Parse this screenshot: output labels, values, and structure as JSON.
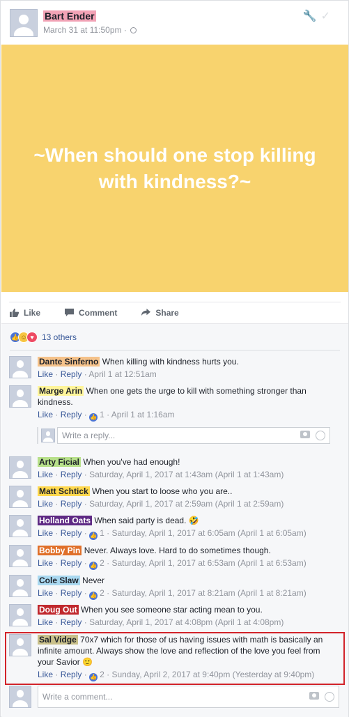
{
  "post": {
    "author": "Bart Ender",
    "author_highlight": "#f2a3b6",
    "timestamp": "March 31 at 11:50pm ·",
    "header_icons": [
      "wrench-icon",
      "checkmark-icon"
    ]
  },
  "banner": {
    "text": "~When should one stop killing with kindness?~",
    "background": "#f8d36e",
    "text_color": "#ffffff"
  },
  "actions": {
    "like": "Like",
    "comment": "Comment",
    "share": "Share"
  },
  "reactions": {
    "types": [
      "like-reaction",
      "haha-reaction",
      "love-reaction"
    ],
    "count": "13 others"
  },
  "comments": [
    {
      "name": "Dante Sinferno",
      "name_highlight": "#f5c28a",
      "text": "When killing with kindness hurts you.",
      "like": "Like",
      "reply": "Reply",
      "likes": "",
      "time": "· April 1 at 12:51am"
    },
    {
      "name": "Marge Arin",
      "name_highlight": "#fff59a",
      "text": "When one gets the urge to kill with something stronger than kindness.",
      "like": "Like",
      "reply": "Reply",
      "likes": "1",
      "time": "· April 1 at 1:16am"
    },
    {
      "name": "Arty Ficial",
      "name_highlight": "#b7e08a",
      "text": "When you've had enough!",
      "like": "Like",
      "reply": "Reply",
      "likes": "",
      "time": "· Saturday, April 1, 2017 at 1:43am (April 1 at 1:43am)"
    },
    {
      "name": "Matt Schtick",
      "name_highlight": "#ffd84d",
      "text": "When you start to loose who you are..",
      "like": "Like",
      "reply": "Reply",
      "likes": "",
      "time": "· Saturday, April 1, 2017 at 2:59am (April 1 at 2:59am)"
    },
    {
      "name": "Holland Oats",
      "name_highlight": "#5e2a84",
      "name_color": "#ffffff",
      "text": "When said party is dead. 🤣",
      "like": "Like",
      "reply": "Reply",
      "likes": "1",
      "time": "· Saturday, April 1, 2017 at 6:05am (April 1 at 6:05am)"
    },
    {
      "name": "Bobby Pin",
      "name_highlight": "#e0702a",
      "name_color": "#ffffff",
      "text": "Never. Always love. Hard to do sometimes though.",
      "like": "Like",
      "reply": "Reply",
      "likes": "2",
      "time": "· Saturday, April 1, 2017 at 6:53am (April 1 at 6:53am)"
    },
    {
      "name": "Cole Slaw",
      "name_highlight": "#a9d8f0",
      "text": "Never",
      "like": "Like",
      "reply": "Reply",
      "likes": "2",
      "time": "· Saturday, April 1, 2017 at 8:21am (April 1 at 8:21am)"
    },
    {
      "name": "Doug Out",
      "name_highlight": "#c0282d",
      "name_color": "#ffffff",
      "text": "When you see someone star acting mean to you.",
      "like": "Like",
      "reply": "Reply",
      "likes": "",
      "time": "· Saturday, April 1, 2017 at 4:08pm (April 1 at 4:08pm)"
    },
    {
      "name": "Sal Vidge",
      "name_highlight": "#c9c08a",
      "text": "70x7 which for those of us having issues with math is basically an infinite amount. Always show the love and reflection of the love you feel from your Savior 🙂",
      "like": "Like",
      "reply": "Reply",
      "likes": "2",
      "time": "· Sunday, April 2, 2017 at 9:40pm (Yesterday at 9:40pm)"
    }
  ],
  "reply_box": {
    "placeholder": "Write a reply..."
  },
  "comment_box": {
    "placeholder": "Write a comment..."
  },
  "highlight_color": "#d2232a"
}
